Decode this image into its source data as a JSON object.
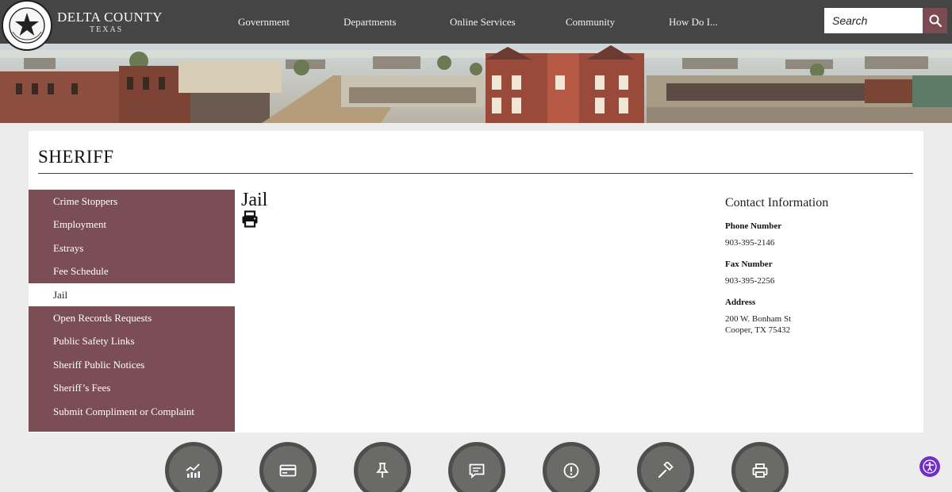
{
  "brand": {
    "name": "DELTA COUNTY",
    "subtitle": "TEXAS",
    "seal_text": "THE STATE OF TEXAS · DELTA COUNTY"
  },
  "nav": [
    "Government",
    "Departments",
    "Online Services",
    "Community",
    "How Do I..."
  ],
  "search": {
    "placeholder": "Search"
  },
  "page": {
    "title": "SHERIFF",
    "content_title": "Jail"
  },
  "sidebar": {
    "items": [
      {
        "label": "Crime Stoppers",
        "active": false
      },
      {
        "label": "Employment",
        "active": false
      },
      {
        "label": "Estrays",
        "active": false
      },
      {
        "label": "Fee Schedule",
        "active": false
      },
      {
        "label": "Jail",
        "active": true
      },
      {
        "label": "Open Records Requests",
        "active": false
      },
      {
        "label": "Public Safety Links",
        "active": false
      },
      {
        "label": "Sheriff Public Notices",
        "active": false
      },
      {
        "label": "Sheriff’s Fees",
        "active": false
      },
      {
        "label": "Submit Compliment or Complaint",
        "active": false
      }
    ]
  },
  "contact": {
    "title": "Contact Information",
    "phone_label": "Phone Number",
    "phone": "903-395-2146",
    "fax_label": "Fax Number",
    "fax": "903-395-2256",
    "address_label": "Address",
    "address_line1": "200 W. Bonham St",
    "address_line2": "Cooper, TX 75432"
  },
  "quick_links": [
    "chart-icon",
    "credit-card-icon",
    "pushpin-icon",
    "comment-icon",
    "alert-icon",
    "gavel-icon",
    "printer-icon"
  ],
  "colors": {
    "header": "#454545",
    "accent": "#7b4d55",
    "quick_circle": "#6a6b69",
    "accessibility": "#6f2fc6"
  }
}
